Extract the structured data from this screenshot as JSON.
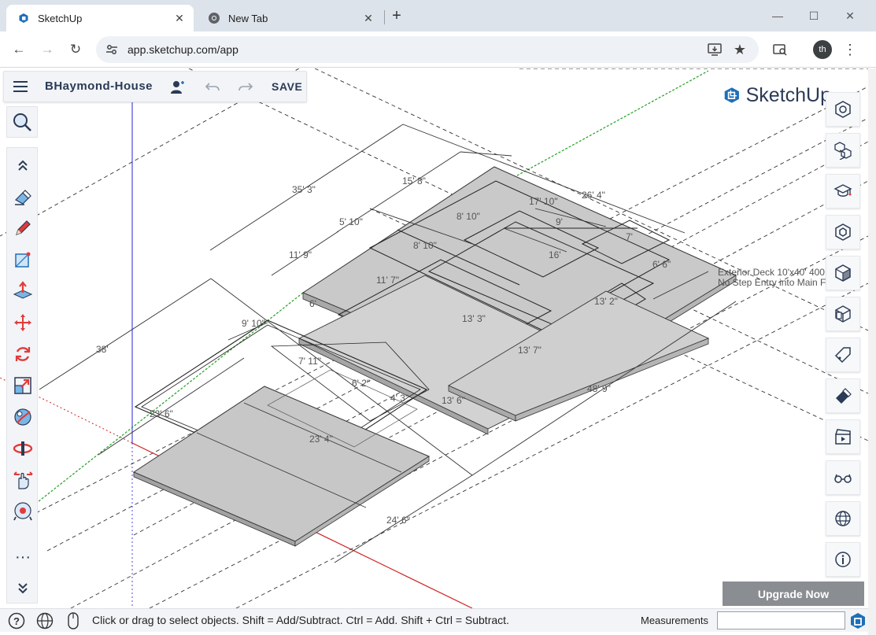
{
  "browser": {
    "tabs": [
      {
        "label": "SketchUp",
        "icon": "sketchup-favicon",
        "active": true
      },
      {
        "label": "New Tab",
        "icon": "chrome-icon",
        "active": false
      }
    ],
    "url": "app.sketchup.com/app",
    "profile_initials": "th"
  },
  "app": {
    "project_title": "BHaymond-House",
    "save_label": "SAVE",
    "logo_text": "SketchUp",
    "upgrade_label": "Upgrade Now"
  },
  "left_tools": [
    "search-tool",
    "collapse",
    "eraser",
    "pencil-line",
    "rectangle",
    "push-pull",
    "move",
    "rotate",
    "scale",
    "orbit",
    "pan",
    "hand",
    "walk",
    "more",
    "expand"
  ],
  "right_panels": [
    "entity-info",
    "components",
    "instructor",
    "materials",
    "styles",
    "scenes",
    "tags",
    "outliner",
    "scene-manager",
    "display",
    "globe-geolocation",
    "info"
  ],
  "model_labels": {
    "dims": [
      "35' 3\"",
      "15' 8\"",
      "26' 4\"",
      "17' 10\"",
      "9'",
      "7'",
      "8' 10\"",
      "5' 10\"",
      "8' 10\"",
      "11' 9\"",
      "16'",
      "6' 6\"",
      "11' 7\"",
      "13' 3\"",
      "13' 2\"",
      "6'",
      "9' 10\"",
      "38'",
      "7' 11\"",
      "6' 2\"",
      "4' 3\"",
      "13' 7\"",
      "13' 6\"",
      "48' 9\"",
      "23' 6\"",
      "23' 4\"",
      "24' 6\""
    ],
    "note_line1": "Exterior Deck 10'x40' 400",
    "note_line2": "No Step Entry into Main F"
  },
  "status": {
    "hint": "Click or drag to select objects. Shift = Add/Subtract. Ctrl = Add. Shift + Ctrl = Subtract.",
    "measurements_label": "Measurements",
    "measurements_value": ""
  }
}
